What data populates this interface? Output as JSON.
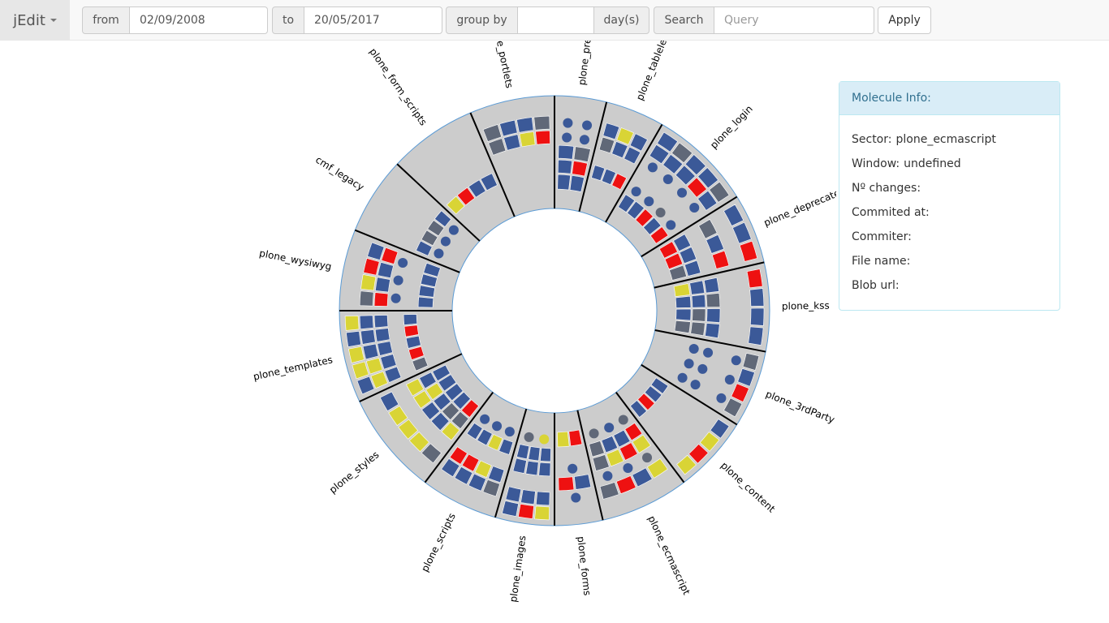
{
  "navbar": {
    "brand": "jEdit",
    "from_label": "from",
    "from_value": "02/09/2008",
    "to_label": "to",
    "to_value": "20/05/2017",
    "group_label": "group by",
    "group_value": "",
    "group_unit": "day(s)",
    "search_label": "Search",
    "search_placeholder": "Query",
    "apply_label": "Apply"
  },
  "chart": {
    "sectors": [
      {
        "name": "plone_prefs",
        "angle": 0
      },
      {
        "name": "plone_tableless",
        "angle": 14
      },
      {
        "name": "plone_login",
        "angle": 30
      },
      {
        "name": "plone_deprecated",
        "angle": 58
      },
      {
        "name": "plone_kss",
        "angle": 77
      },
      {
        "name": "plone_3rdParty",
        "angle": 101
      },
      {
        "name": "plone_content",
        "angle": 122
      },
      {
        "name": "plone_ecmascript",
        "angle": 143
      },
      {
        "name": "plone_forms",
        "angle": 167
      },
      {
        "name": "plone_images",
        "angle": 180
      },
      {
        "name": "plone_scripts",
        "angle": 196
      },
      {
        "name": "plone_styles",
        "angle": 217
      },
      {
        "name": "plone_templates",
        "angle": 245
      },
      {
        "name": "plone_wysiwyg",
        "angle": 270
      },
      {
        "name": "cmf_legacy",
        "angle": 292
      },
      {
        "name": "plone_form_scripts",
        "angle": 313
      },
      {
        "name": "plone_portlets",
        "angle": 337
      }
    ],
    "colors": {
      "background": "#cccccc",
      "blue": "#3b5998",
      "yellow": "#d9d435",
      "red": "#ee1111",
      "gray": "#606878",
      "ring": "#5b9bd5"
    }
  },
  "info": {
    "title": "Molecule Info:",
    "rows": [
      {
        "label": "Sector:",
        "value": "plone_ecmascript"
      },
      {
        "label": "Window:",
        "value": "undefined"
      },
      {
        "label": "Nº changes:",
        "value": ""
      },
      {
        "label": "Commited at:",
        "value": ""
      },
      {
        "label": "Commiter:",
        "value": ""
      },
      {
        "label": "File name:",
        "value": ""
      },
      {
        "label": "Blob url:",
        "value": ""
      }
    ]
  }
}
